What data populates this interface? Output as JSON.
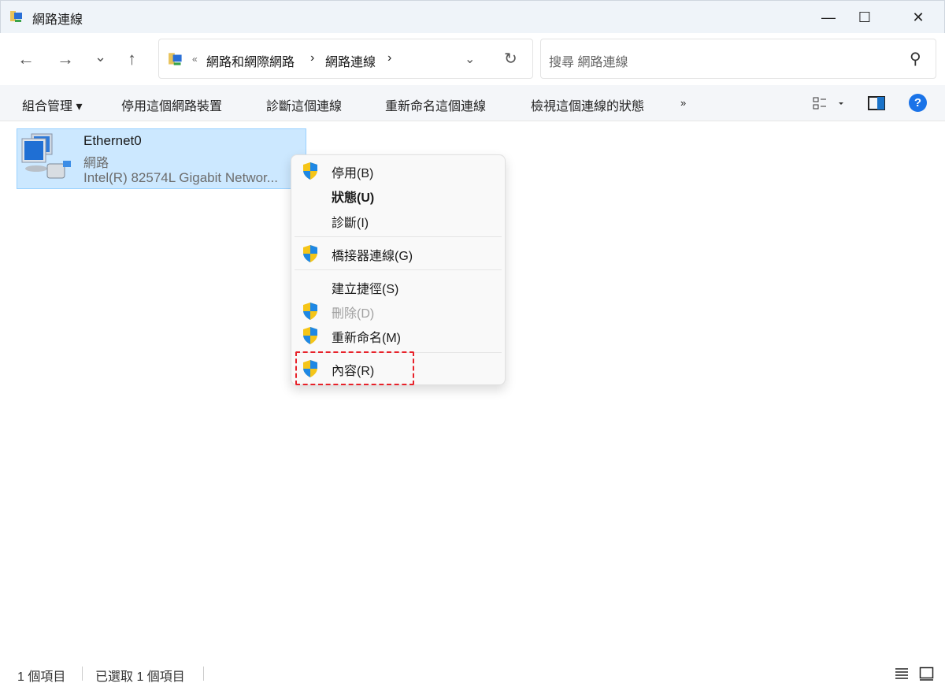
{
  "window": {
    "title": "網路連線",
    "minimize": "—",
    "maximize": "☐",
    "close": "✕"
  },
  "nav": {
    "back": "←",
    "forward": "→",
    "recent": "⌄",
    "up": "↑"
  },
  "address": {
    "overflow": "«",
    "crumbs": [
      "網路和網際網路",
      "網路連線"
    ],
    "sep": "›",
    "dropdown": "⌄",
    "refresh": "↻"
  },
  "search": {
    "placeholder": "搜尋 網路連線",
    "icon": "⚲"
  },
  "commands": {
    "organize": "組合管理 ▾",
    "disable": "停用這個網路裝置",
    "diagnose": "診斷這個連線",
    "rename": "重新命名這個連線",
    "status": "檢視這個連線的狀態",
    "more": "»",
    "help": "?"
  },
  "item": {
    "name": "Ethernet0",
    "type": "網路",
    "device": "Intel(R) 82574L Gigabit Networ..."
  },
  "menu": [
    {
      "label": "停用(B)",
      "shield": true
    },
    {
      "label": "狀態(U)",
      "shield": false,
      "bold": true
    },
    {
      "label": "診斷(I)",
      "shield": false
    },
    {
      "label": "橋接器連線(G)",
      "shield": true
    },
    {
      "label": "建立捷徑(S)",
      "shield": false
    },
    {
      "label": "刪除(D)",
      "shield": true,
      "disabled": true
    },
    {
      "label": "重新命名(M)",
      "shield": true
    },
    {
      "label": "內容(R)",
      "shield": true,
      "highlighted": true
    }
  ],
  "statusbar": {
    "count": "1 個項目",
    "selected": "已選取 1 個項目"
  }
}
